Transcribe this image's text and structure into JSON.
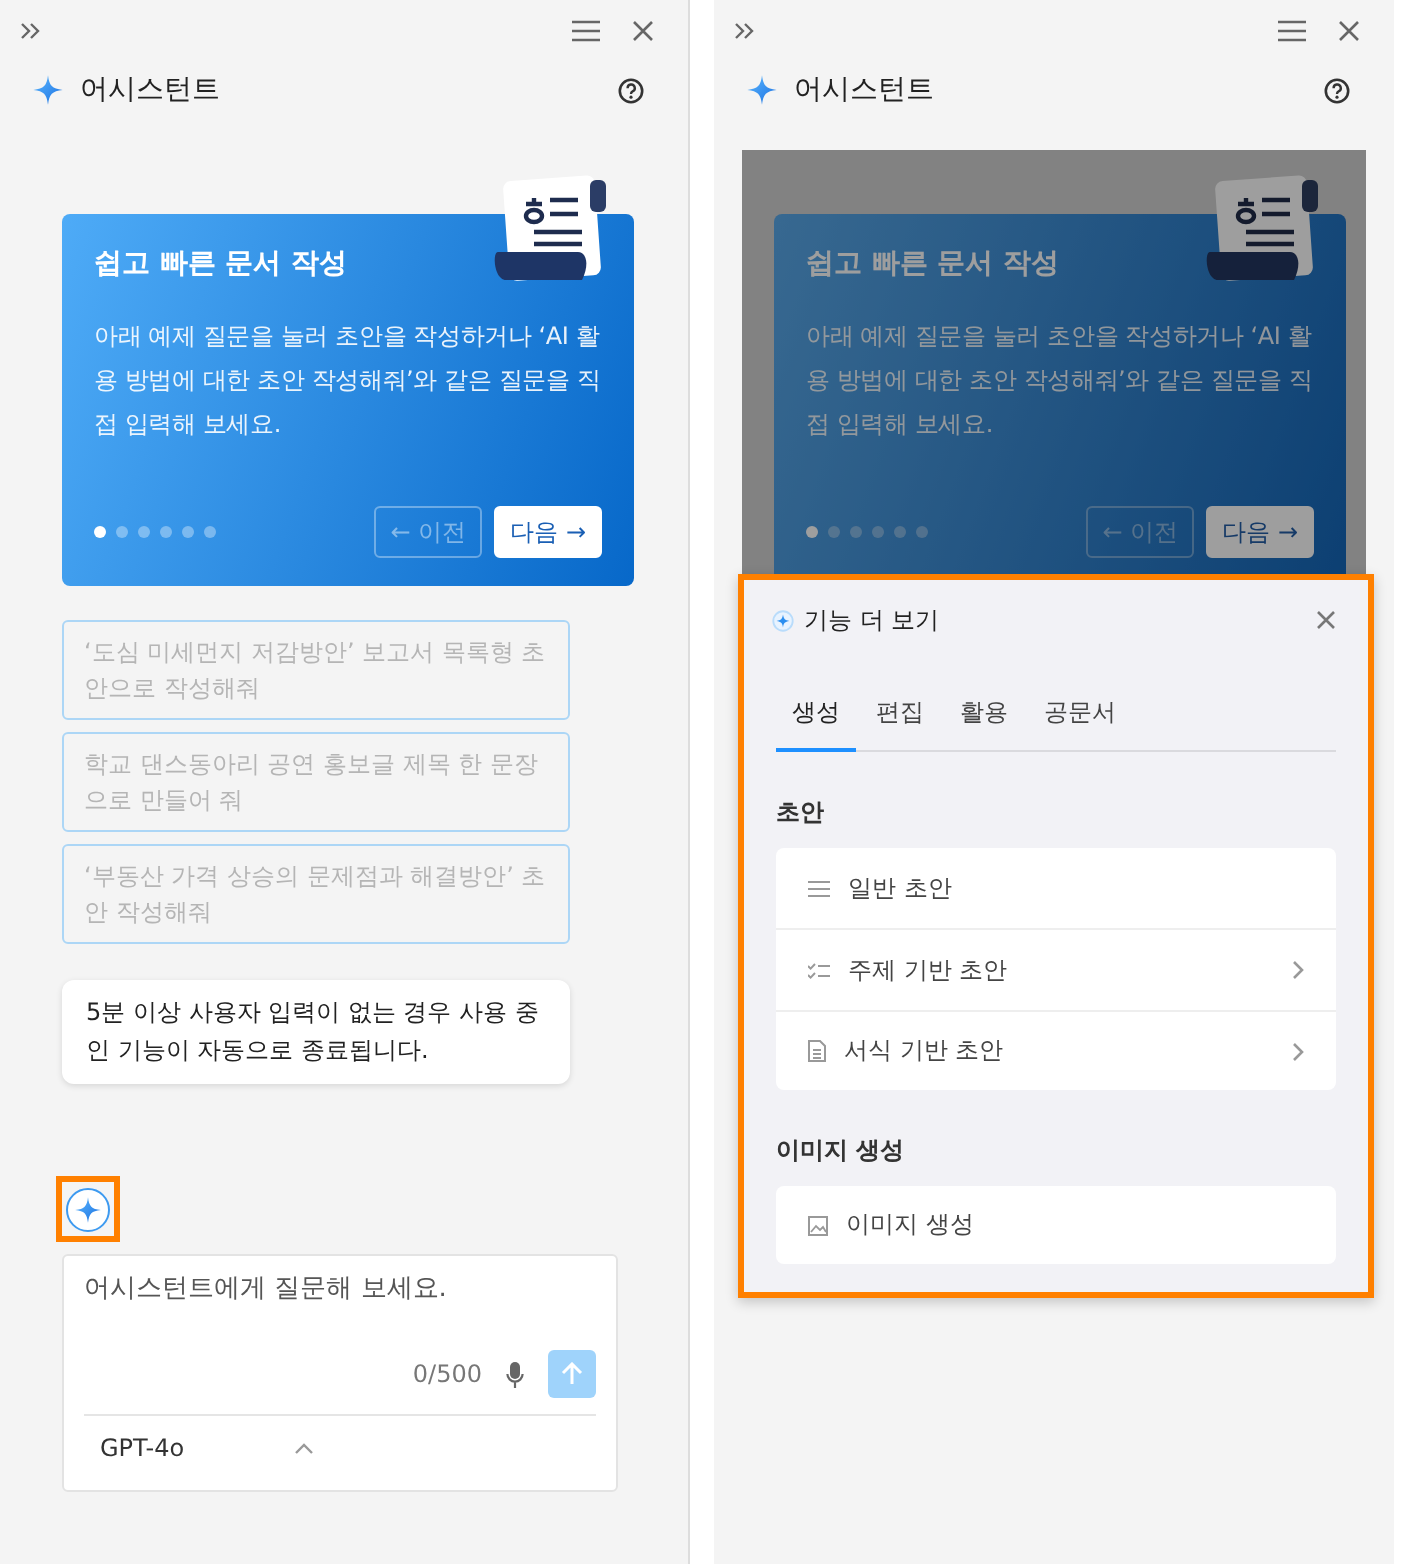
{
  "left_panel": {
    "title": "어시스턴트",
    "carousel": {
      "title": "쉽고 빠른 문서 작성",
      "body": "아래 예제 질문을 눌러 초안을 작성하거나 ‘AI 활용 방법에 대한 초안 작성해줘’와 같은 질문을 직접 입력해 보세요.",
      "dots": [
        {
          "selected": true
        },
        {
          "selected": false
        },
        {
          "selected": false
        },
        {
          "selected": false
        },
        {
          "selected": false
        },
        {
          "selected": false
        }
      ],
      "prev_button": {
        "label": "← 이전",
        "disabled": true
      },
      "next_button": {
        "label": "다음 →",
        "disabled": false
      }
    },
    "suggestions": [
      "‘도심 미세먼지 저감방안’ 보고서 목록형 초안으로 작성해줘",
      "학교 댄스동아리 공연 홍보글 제목 한 문장으로 만들어 줘",
      "‘부동산 가격 상승의 문제점과 해결방안’ 초안 작성해줘"
    ],
    "notice": "5분 이상 사용자 입력이 없는 경우 사용 중인 기능이 자동으로 종료됩니다.",
    "assistant_button": {
      "highlighted": true
    },
    "composer": {
      "placeholder": "어시스턴트에게 질문해 보세요.",
      "counter": "0/500",
      "send_disabled": true,
      "model": "GPT-4o"
    }
  },
  "right_panel": {
    "title": "어시스턴트",
    "dimmed": true,
    "carousel": {
      "title": "쉽고 빠른 문서 작성",
      "body": "아래 예제 질문을 눌러 초안을 작성하거나 ‘AI 활용 방법에 대한 초안 작성해줘’와 같은 질문을 직접 입력해 보세요.",
      "dots": [
        {
          "selected": true
        },
        {
          "selected": false
        },
        {
          "selected": false
        },
        {
          "selected": false
        },
        {
          "selected": false
        },
        {
          "selected": false
        }
      ],
      "prev_button": {
        "label": "← 이전",
        "disabled": true
      },
      "next_button": {
        "label": "다음 →",
        "disabled": false
      }
    },
    "feature_panel": {
      "title": "기능 더 보기",
      "highlighted": true,
      "tabs": [
        {
          "label": "생성",
          "selected": true
        },
        {
          "label": "편집",
          "selected": false
        },
        {
          "label": "활용",
          "selected": false
        },
        {
          "label": "공문서",
          "selected": false
        }
      ],
      "sections": [
        {
          "heading": "초안",
          "items": [
            {
              "label": "일반 초안",
              "kind": "lines",
              "has_submenu": false
            },
            {
              "label": "주제 기반 초안",
              "kind": "checklist",
              "has_submenu": true
            },
            {
              "label": "서식 기반 초안",
              "kind": "document",
              "has_submenu": true
            }
          ]
        },
        {
          "heading": "이미지 생성",
          "items": [
            {
              "label": "이미지 생성",
              "kind": "image",
              "has_submenu": false
            }
          ]
        }
      ]
    }
  }
}
